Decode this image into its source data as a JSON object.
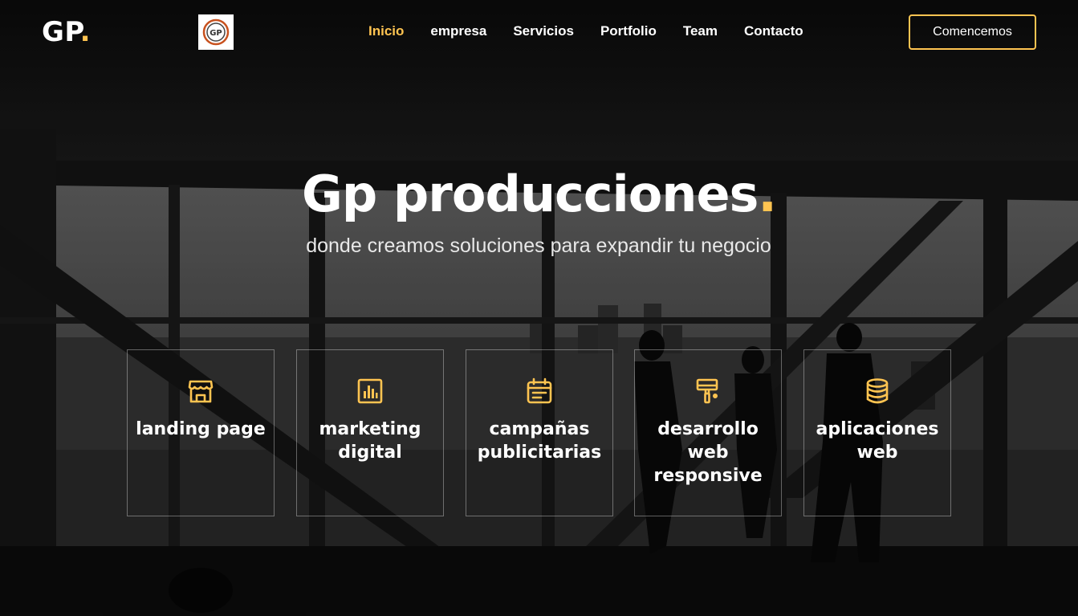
{
  "header": {
    "logo_text": "GP",
    "logo_dot": ".",
    "logo_image_text": "GP",
    "nav": [
      {
        "label": "Inicio",
        "active": true
      },
      {
        "label": "empresa",
        "active": false
      },
      {
        "label": "Servicios",
        "active": false
      },
      {
        "label": "Portfolio",
        "active": false
      },
      {
        "label": "Team",
        "active": false
      },
      {
        "label": "Contacto",
        "active": false
      }
    ],
    "cta_label": "Comencemos"
  },
  "hero": {
    "title": "Gp producciones",
    "title_dot": ".",
    "subtitle": "donde creamos soluciones para expandir tu negocio"
  },
  "services": [
    {
      "label": "landing page",
      "icon": "store-icon"
    },
    {
      "label": "marketing digital",
      "icon": "bar-chart-icon"
    },
    {
      "label": "campañas publicitarias",
      "icon": "calendar-icon"
    },
    {
      "label": "desarrollo web responsive",
      "icon": "paint-roller-icon"
    },
    {
      "label": "aplicaciones web",
      "icon": "database-icon"
    }
  ],
  "colors": {
    "accent": "#ffc451",
    "text": "#ffffff",
    "background": "#0e0e0e"
  }
}
